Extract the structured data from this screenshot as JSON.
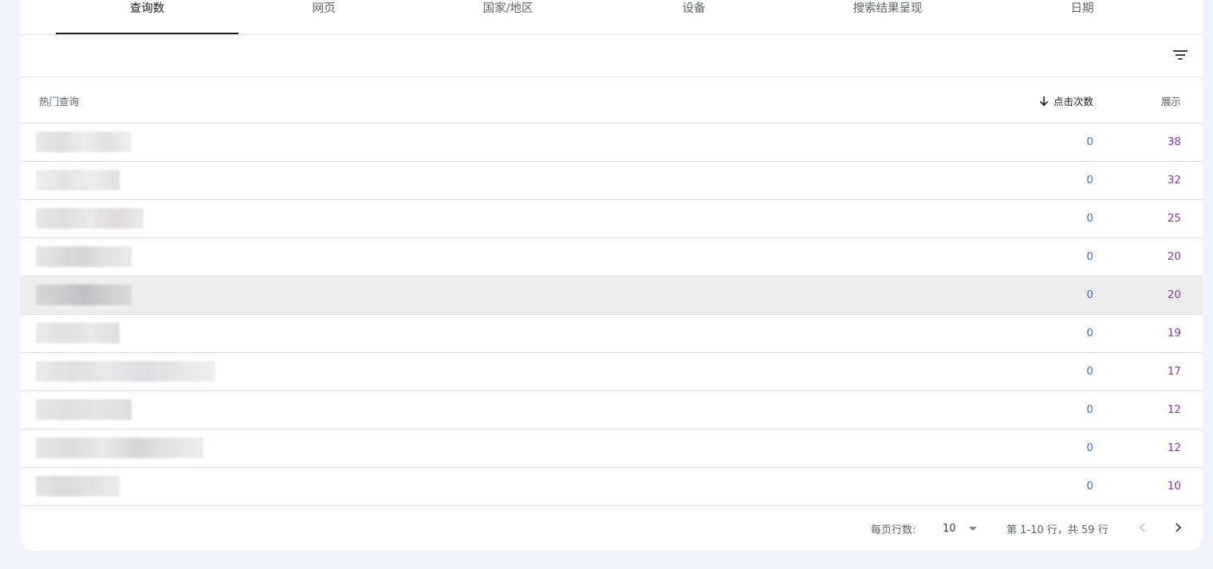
{
  "tabs": [
    {
      "label": "查询数",
      "active": true
    },
    {
      "label": "网页",
      "active": false
    },
    {
      "label": "国家/地区",
      "active": false
    },
    {
      "label": "设备",
      "active": false
    },
    {
      "label": "搜索结果呈现",
      "active": false
    },
    {
      "label": "日期",
      "active": false
    }
  ],
  "toolbar": {
    "filter_icon": "filter-icon"
  },
  "table": {
    "headers": {
      "query": "热门查询",
      "clicks": "点击次数",
      "impressions": "展示",
      "sort_icon": "arrow-down-icon"
    },
    "rows": [
      {
        "clicks": "0",
        "impressions": "38"
      },
      {
        "clicks": "0",
        "impressions": "32"
      },
      {
        "clicks": "0",
        "impressions": "25"
      },
      {
        "clicks": "0",
        "impressions": "20"
      },
      {
        "clicks": "0",
        "impressions": "20"
      },
      {
        "clicks": "0",
        "impressions": "19"
      },
      {
        "clicks": "0",
        "impressions": "17"
      },
      {
        "clicks": "0",
        "impressions": "12"
      },
      {
        "clicks": "0",
        "impressions": "12"
      },
      {
        "clicks": "0",
        "impressions": "10"
      }
    ]
  },
  "pagination": {
    "rows_per_page_label": "每页行数:",
    "rows_per_page_value": "10",
    "range_text": "第 1-10 行，共 59 行",
    "prev_icon": "chevron-left-icon",
    "next_icon": "chevron-right-icon"
  },
  "colors": {
    "clicks": "#4470c2",
    "impressions": "#8a3ab0",
    "background": "#f1f4fc",
    "hover_row": "#ededed"
  }
}
